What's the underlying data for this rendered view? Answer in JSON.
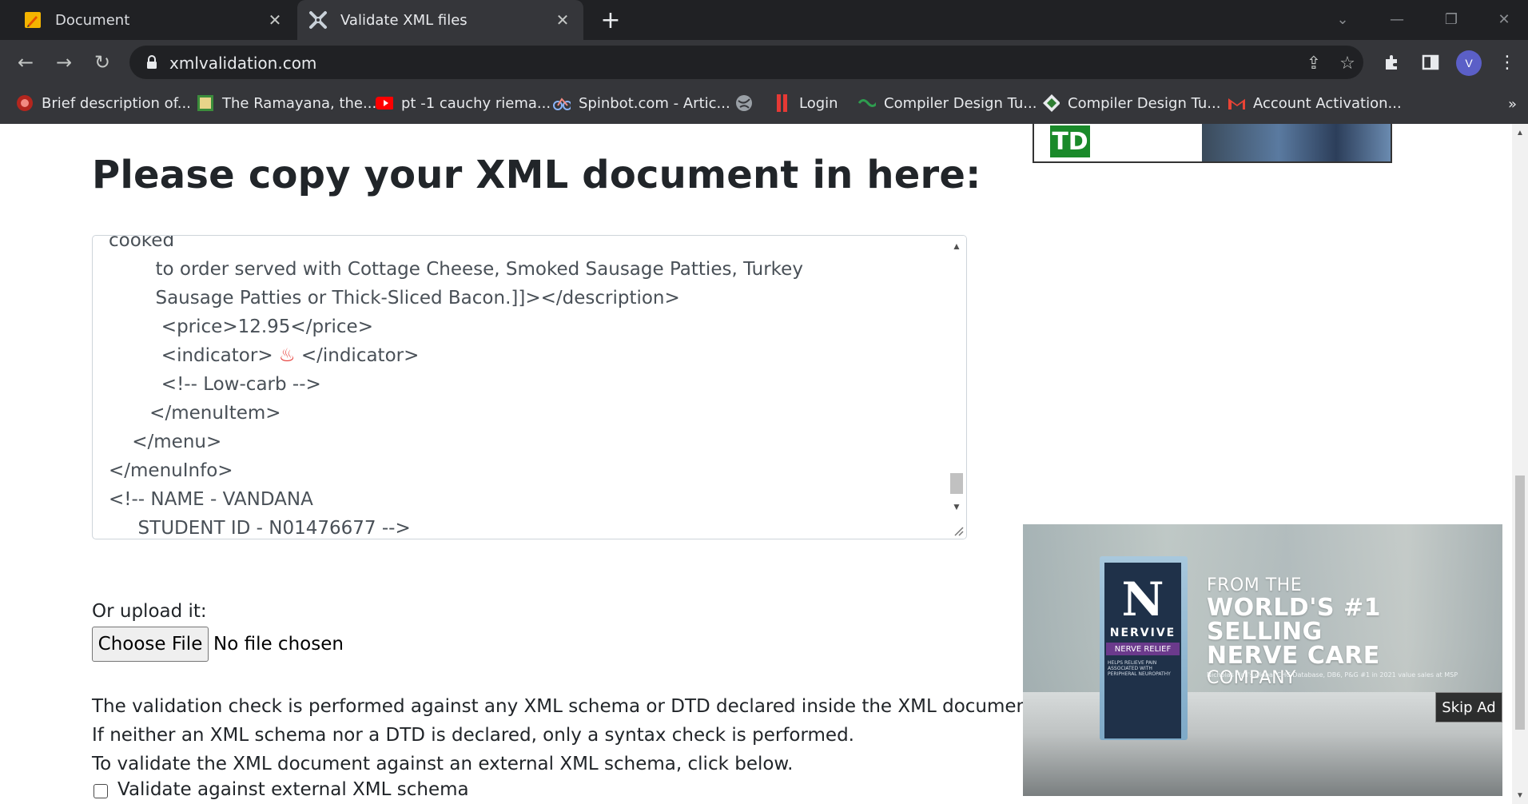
{
  "browser": {
    "tabs": [
      {
        "title": "Document",
        "active": false,
        "icon": "pencil-note-icon"
      },
      {
        "title": "Validate XML files",
        "active": true,
        "icon": "xml-tools-icon"
      }
    ],
    "url": "xmlvalidation.com",
    "profile_initial": "V",
    "bookmarks": [
      {
        "label": "Brief description of...",
        "icon": "red-seal-icon"
      },
      {
        "label": "The Ramayana, the...",
        "icon": "image-icon"
      },
      {
        "label": "pt -1 cauchy riema...",
        "icon": "youtube-icon"
      },
      {
        "label": "Spinbot.com - Artic...",
        "icon": "bicycle-icon"
      },
      {
        "label": "",
        "icon": "globe-icon"
      },
      {
        "label": "Login",
        "icon": "red-bars-icon"
      },
      {
        "label": "Compiler Design Tu...",
        "icon": "green-logo-icon"
      },
      {
        "label": "Compiler Design Tu...",
        "icon": "diamond-logo-icon"
      },
      {
        "label": "Account Activation...",
        "icon": "gmail-icon"
      }
    ]
  },
  "main": {
    "heading": "Please copy your XML document in here:",
    "editor_lines": [
      "cooked",
      "        to order served with Cottage Cheese, Smoked Sausage Patties, Turkey",
      "        Sausage Patties or Thick-Sliced Bacon.]]></description>",
      "         <price>12.95</price>",
      "         <indicator> ♨ </indicator>",
      "         <!-- Low-carb -->",
      "       </menuItem>",
      "    </menu>",
      "</menuInfo>",
      "<!-- NAME - VANDANA",
      "     STUDENT ID - N01476677 -->"
    ],
    "upload_label": "Or upload it:",
    "choose_file_label": "Choose File",
    "no_file_text": "No file chosen",
    "info_lines": [
      "The validation check is performed against any XML schema or DTD declared inside the XML document.",
      "If neither an XML schema nor a DTD is declared, only a syntax check is performed.",
      "To validate the XML document against an external XML schema, click below."
    ],
    "checkbox_label": "Validate against external XML schema",
    "checkbox_checked": false
  },
  "ads": {
    "top_banner_logo": "TD",
    "video": {
      "brand_letter": "N",
      "brand": "NERVIVE",
      "sub_brand": "NERVE RELIEF",
      "box_fine_print": "HELPS RELIEVE PAIN ASSOCIATED WITH PERIPHERAL NEUROPATHY",
      "headline_1": "FROM THE",
      "headline_2": "WORLD'S #1 SELLING",
      "headline_3": "NERVE CARE",
      "headline_4": "COMPANY",
      "disclaimer": "Nicholas Hall's global CHC Database, DB6, P&G #1 in 2021 value sales at MSP",
      "skip_label": "Skip Ad"
    }
  },
  "colors": {
    "chrome_dark": "#202124",
    "chrome_toolbar": "#35363a",
    "text_dark": "#212529",
    "editor_text": "#495057"
  }
}
